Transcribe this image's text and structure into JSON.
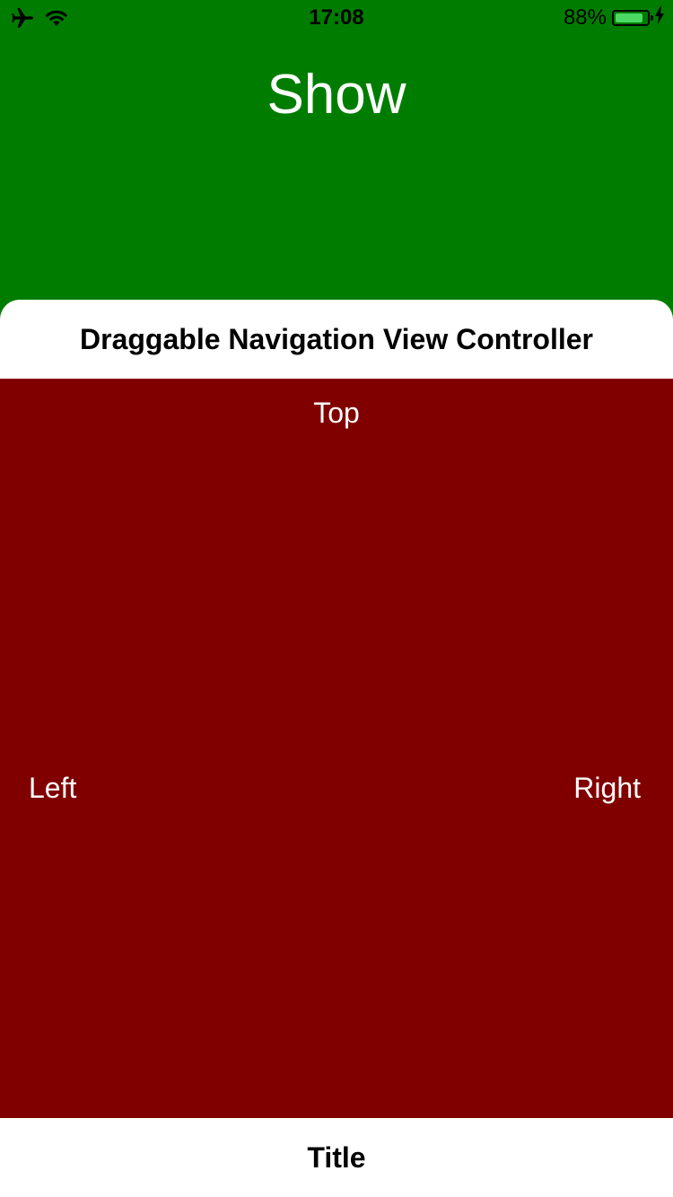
{
  "status_bar": {
    "time": "17:08",
    "battery_percent": "88%",
    "battery_level": 0.88,
    "battery_color": "#4cd964",
    "icons": [
      "airplane-icon",
      "wifi-icon",
      "charging-icon"
    ]
  },
  "main": {
    "title": "Show",
    "background": "#007d00"
  },
  "panel": {
    "header_title": "Draggable Navigation View Controller",
    "background": "#800000",
    "labels": {
      "top": "Top",
      "left": "Left",
      "right": "Right"
    }
  },
  "bottom_bar": {
    "title": "Title"
  }
}
